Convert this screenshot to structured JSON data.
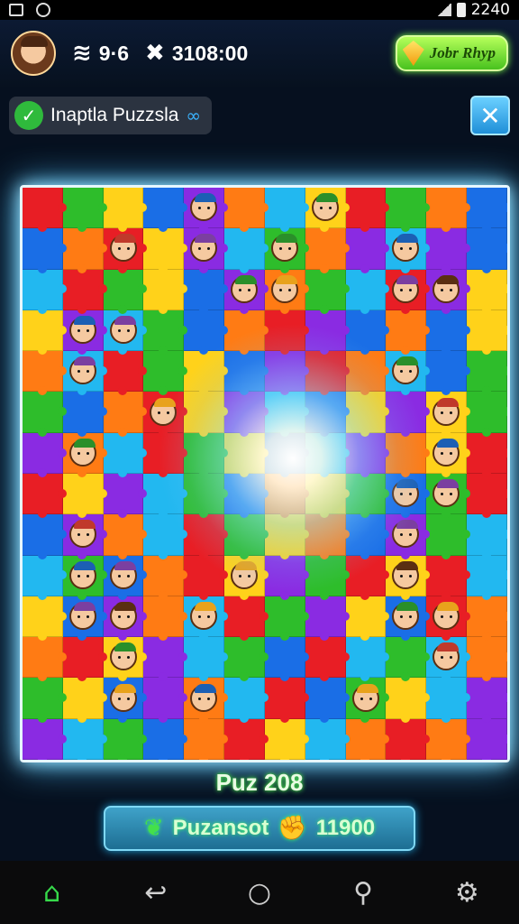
{
  "status_bar": {
    "time": "2240"
  },
  "top_bar": {
    "stat_left": {
      "icon": "wifi-wave-icon",
      "value": "9·6"
    },
    "stat_mid": {
      "icon": "cross-icon",
      "value": "3108:00"
    },
    "gem_button": {
      "icon": "gem-icon",
      "label": "Jobr Rhyp"
    }
  },
  "sub_bar": {
    "title": "Inaptla Puzzsla",
    "check_icon": "check-icon",
    "link_icon": "link-icon",
    "close_icon": "close-icon"
  },
  "board": {
    "columns": 12,
    "rows": 14,
    "colors": [
      "#e81e25",
      "#2ebd2b",
      "#ffd21a",
      "#1a6ee6",
      "#8a2be2",
      "#ff7b14",
      "#22b8f0"
    ]
  },
  "footer": {
    "level_label": "Puz 208",
    "progress_button": {
      "left_icon": "leaf-icon",
      "label": "Puzansot",
      "right_icon": "thumb-icon",
      "value": "11900"
    }
  },
  "nav": [
    {
      "name": "home",
      "icon": "home-icon",
      "glyph": "⌂"
    },
    {
      "name": "back",
      "icon": "back-icon",
      "glyph": "↩"
    },
    {
      "name": "circle",
      "icon": "circle-icon",
      "glyph": "○"
    },
    {
      "name": "search",
      "icon": "search-icon",
      "glyph": "⚲"
    },
    {
      "name": "settings",
      "icon": "gear-icon",
      "glyph": "⚙"
    }
  ]
}
